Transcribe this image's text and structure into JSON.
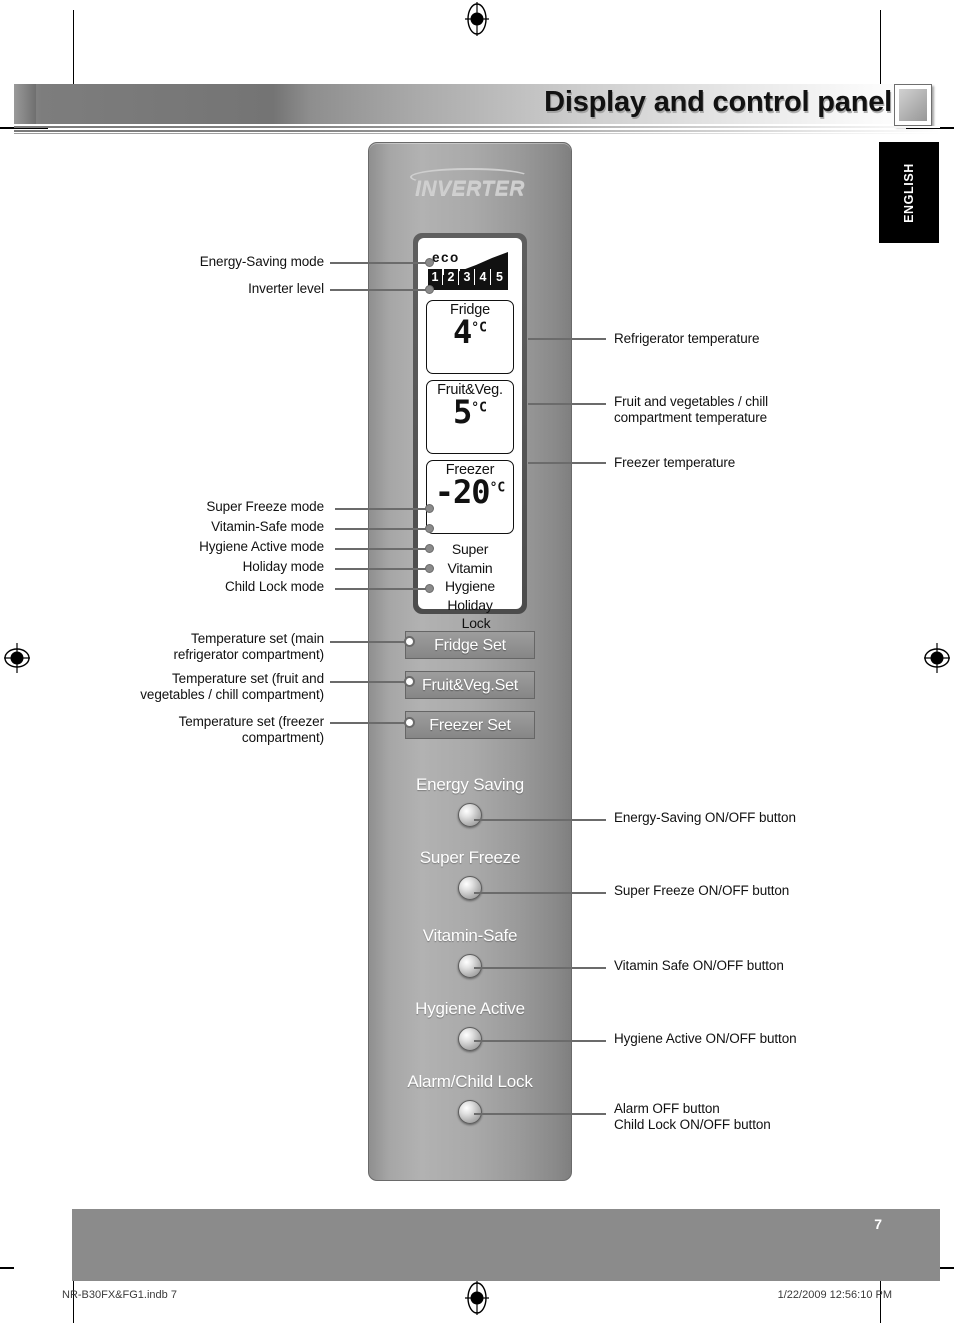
{
  "header": {
    "title": "Display and control panel",
    "language_tab": "ENGLISH"
  },
  "panel": {
    "brand": "INVERTER",
    "lcd": {
      "eco_label": "eco",
      "inverter_levels": [
        "1",
        "2",
        "3",
        "4",
        "5"
      ],
      "readouts": [
        {
          "caption": "Fridge",
          "value": "4",
          "unit": "°C"
        },
        {
          "caption": "Fruit&Veg.",
          "value": "5",
          "unit": "°C"
        },
        {
          "caption": "Freezer",
          "value": "-20",
          "unit": "°C"
        }
      ],
      "mode_indicators": [
        "Super",
        "Vitamin",
        "Hygiene",
        "Holiday",
        "Lock"
      ]
    },
    "set_buttons": [
      "Fridge Set",
      "Fruit&Veg.Set",
      "Freezer Set"
    ],
    "feature_buttons": [
      "Energy Saving",
      "Super Freeze",
      "Vitamin-Safe",
      "Hygiene Active",
      "Alarm/Child Lock"
    ]
  },
  "callouts": {
    "left": [
      "Energy-Saving mode",
      "Inverter level",
      "Super Freeze mode",
      "Vitamin-Safe mode",
      "Hygiene Active mode",
      "Holiday mode",
      "Child Lock mode",
      "Temperature set (main refrigerator compartment)",
      "Temperature set (fruit and vegetables / chill compartment)",
      "Temperature set (freezer compartment)"
    ],
    "left_lines": {
      "temp_main_1": "Temperature set (main",
      "temp_main_2": "refrigerator compartment)",
      "temp_fruit_1": "Temperature set (fruit and",
      "temp_fruit_2": "vegetables / chill compartment)",
      "temp_freezer_1": "Temperature set (freezer",
      "temp_freezer_2": "compartment)"
    },
    "right": {
      "refrigerator_temp": "Refrigerator temperature",
      "fruit_temp_1": "Fruit and vegetables / chill",
      "fruit_temp_2": "compartment temperature",
      "freezer_temp": "Freezer temperature",
      "energy_saving_btn": "Energy-Saving ON/OFF button",
      "super_freeze_btn": "Super Freeze ON/OFF button",
      "vitamin_safe_btn": "Vitamin Safe ON/OFF button",
      "hygiene_active_btn": "Hygiene Active ON/OFF button",
      "alarm_btn_1": "Alarm OFF button",
      "alarm_btn_2": "Child Lock ON/OFF button"
    }
  },
  "footer": {
    "page_number": "7",
    "file_name": "NR-B30FX&FG1.indb   7",
    "timestamp": "1/22/2009   12:56:10 PM"
  }
}
